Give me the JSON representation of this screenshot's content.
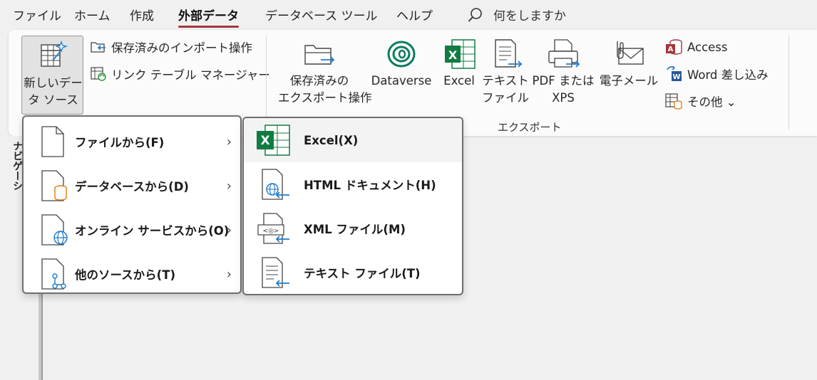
{
  "menubar": {
    "tabs": [
      "ファイル",
      "ホーム",
      "作成",
      "外部データ",
      "データベース ツール",
      "ヘルプ"
    ],
    "active_tab": "外部データ",
    "search_placeholder": "何をしますか"
  },
  "ribbon": {
    "new_source": {
      "line1": "新しいデー",
      "line2": "タ ソース ⌄"
    },
    "saved_imports": "保存済みのインポート操作",
    "linked_table_manager": "リンク テーブル マネージャー",
    "saved_exports": {
      "line1": "保存済みの",
      "line2": "エクスポート操作"
    },
    "dataverse": "Dataverse",
    "excel": "Excel",
    "text_file": {
      "line1": "テキスト",
      "line2": "ファイル"
    },
    "pdf_xps": {
      "line1": "PDF または",
      "line2": "XPS"
    },
    "email": "電子メール",
    "access": "Access",
    "word_merge": "Word 差し込み",
    "more": "その他 ⌄",
    "export_group_label": "エクスポート"
  },
  "navpane": {
    "label": "ナビゲーシ"
  },
  "source_menu": {
    "items": [
      {
        "label": "ファイルから(F)",
        "icon": "file-icon"
      },
      {
        "label": "データベースから(D)",
        "icon": "database-file-icon"
      },
      {
        "label": "オンライン サービスから(O)",
        "icon": "online-service-icon"
      },
      {
        "label": "他のソースから(T)",
        "icon": "other-source-icon"
      }
    ],
    "chevron": "›"
  },
  "file_submenu": {
    "items": [
      {
        "label": "Excel(X)",
        "icon": "excel-icon"
      },
      {
        "label": "HTML ドキュメント(H)",
        "icon": "html-document-icon"
      },
      {
        "label": "XML ファイル(M)",
        "icon": "xml-file-icon"
      },
      {
        "label": "テキスト ファイル(T)",
        "icon": "text-file-icon"
      }
    ]
  },
  "colors": {
    "accent": "#a4373a",
    "excel": "#107c41",
    "arrow": "#1f7bc9",
    "access": "#a4373a",
    "word": "#2b579a"
  }
}
